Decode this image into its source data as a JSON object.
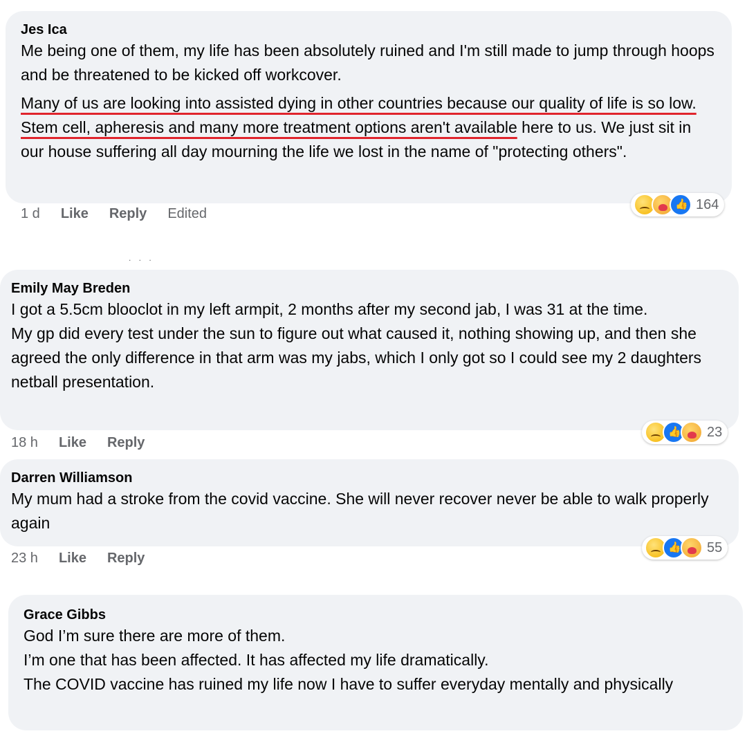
{
  "comments": [
    {
      "author": "Jes Ica",
      "paragraphs": [
        "Me being one of them, my life has been absolutely ruined and I'm still made to jump through hoops and be threatened to be kicked off workcover.",
        ""
      ],
      "para2_underlined": "Many of us are looking into assisted dying in other countries because our quality of life is so low. Stem cell, apheresis and many more treatment options aren't available",
      "para2_rest": " here to us. We just sit in our house suffering all day mourning the life we lost in the name of \"protecting others\".",
      "time": "1 d",
      "like": "Like",
      "reply": "Reply",
      "edited": "Edited",
      "reactions": [
        "sad-emoji-icon",
        "care-emoji-icon",
        "like-emoji-icon"
      ],
      "reaction_count": "164"
    },
    {
      "author": "Emily May Breden",
      "lines": [
        "I got a 5.5cm blooclot in my left armpit, 2 months after my second jab, I was 31 at the time.",
        "My gp did every test under the sun to figure out what caused it, nothing showing up, and then she agreed the only difference in that arm was my jabs, which I only got so I could see my 2 daughters netball presentation."
      ],
      "time": "18 h",
      "like": "Like",
      "reply": "Reply",
      "reactions": [
        "sad-emoji-icon",
        "like-emoji-icon",
        "care-emoji-icon"
      ],
      "reaction_count": "23"
    },
    {
      "author": "Darren Williamson",
      "lines": [
        "My mum had a stroke from the covid vaccine. She will never recover never be able to walk properly again"
      ],
      "time": "23 h",
      "like": "Like",
      "reply": "Reply",
      "reactions": [
        "sad-emoji-icon",
        "like-emoji-icon",
        "care-emoji-icon"
      ],
      "reaction_count": "55"
    },
    {
      "author": "Grace Gibbs",
      "lines": [
        "God I’m sure there are more of them.",
        "I’m one that has been affected. It has affected my life dramatically.",
        "The COVID vaccine has ruined my life now I have to suffer everyday mentally and physically"
      ]
    }
  ],
  "colors": {
    "bubble": "#f0f2f5",
    "meta": "#65676b",
    "underline": "#e0242c",
    "like_blue": "#1877f2"
  }
}
